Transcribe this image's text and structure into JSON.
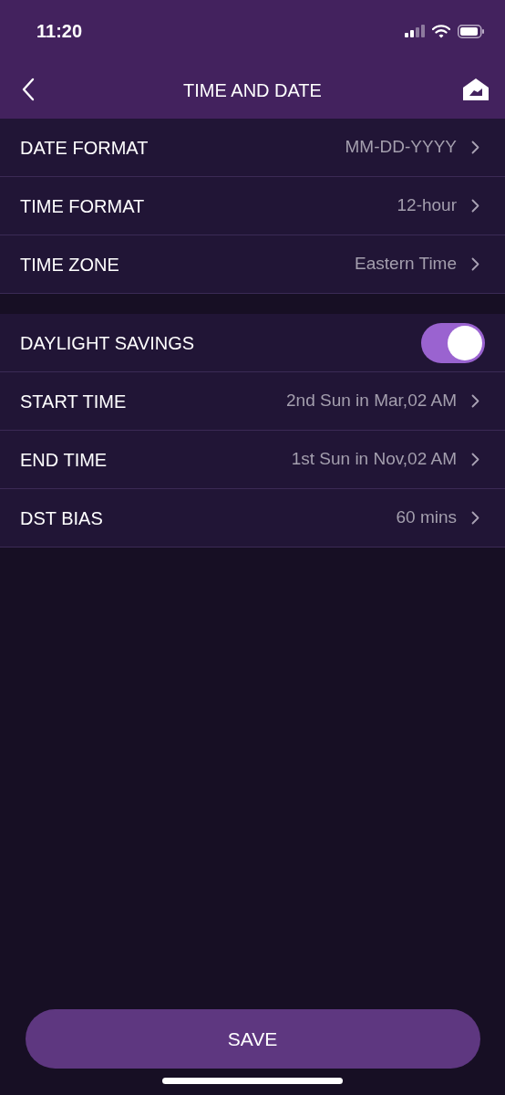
{
  "status_bar": {
    "time": "11:20"
  },
  "header": {
    "title": "TIME AND DATE"
  },
  "sections": [
    {
      "rows": [
        {
          "kind": "nav",
          "label": "DATE FORMAT",
          "value": "MM-DD-YYYY"
        },
        {
          "kind": "nav",
          "label": "TIME FORMAT",
          "value": "12-hour"
        },
        {
          "kind": "nav",
          "label": "TIME ZONE",
          "value": "Eastern Time"
        }
      ]
    },
    {
      "rows": [
        {
          "kind": "toggle",
          "label": "DAYLIGHT SAVINGS",
          "on": true
        },
        {
          "kind": "nav",
          "label": "START TIME",
          "value": "2nd Sun in Mar,02 AM"
        },
        {
          "kind": "nav",
          "label": "END TIME",
          "value": "1st Sun in Nov,02 AM"
        },
        {
          "kind": "nav",
          "label": "DST BIAS",
          "value": "60 mins"
        }
      ]
    }
  ],
  "save_button": {
    "label": "SAVE"
  }
}
